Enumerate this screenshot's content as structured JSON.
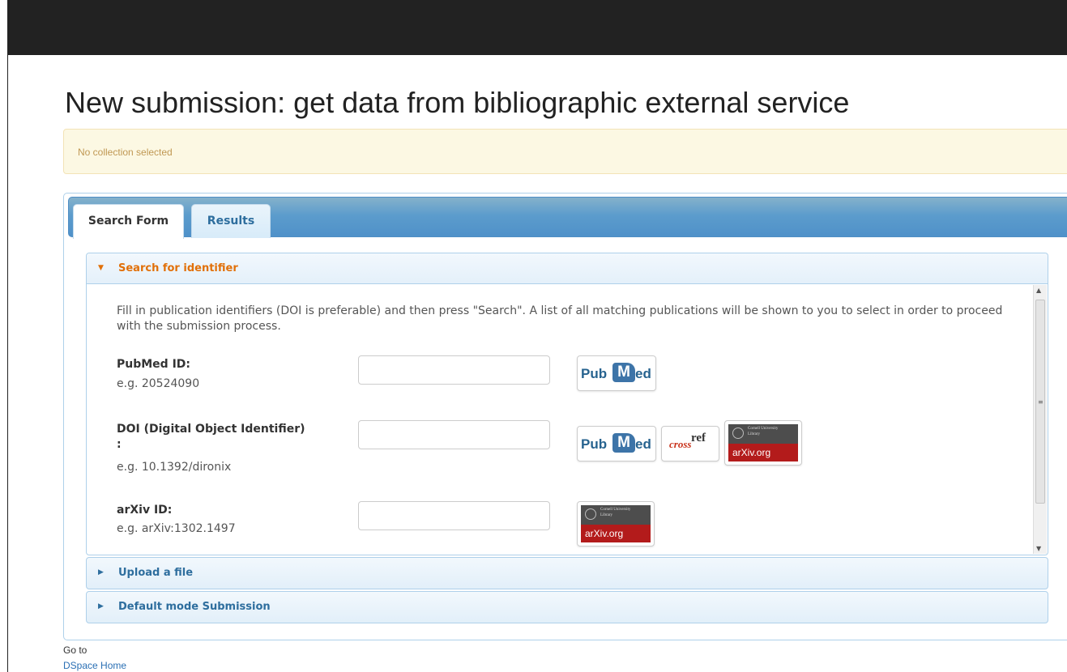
{
  "header": {
    "title": "New submission: get data from bibliographic external service"
  },
  "alert": {
    "text": "No collection selected"
  },
  "tabs": [
    {
      "label": "Search Form",
      "active": true
    },
    {
      "label": "Results",
      "active": false
    }
  ],
  "accordion": {
    "search": {
      "label": "Search for identifier",
      "description": "Fill in publication identifiers (DOI is preferable) and then press \"Search\". A list of all matching publications will be shown to you to select in order to proceed with the submission process.",
      "fields": [
        {
          "label": "PubMed ID:",
          "example": "e.g. 20524090",
          "value": "",
          "providers": [
            "pubmed"
          ]
        },
        {
          "label": "DOI (Digital Object Identifier)\n:",
          "example": "e.g. 10.1392/dironix",
          "value": "",
          "providers": [
            "pubmed",
            "crossref",
            "arxiv"
          ]
        },
        {
          "label": "arXiv ID:",
          "example": "e.g. arXiv:1302.1497",
          "value": "",
          "providers": [
            "arxiv"
          ]
        }
      ]
    },
    "upload": {
      "label": "Upload a file"
    },
    "default": {
      "label": "Default mode Submission"
    }
  },
  "logos": {
    "pubmed": {
      "pub": "Pub",
      "m": "M",
      "ed": "ed"
    },
    "crossref": {
      "part1": "cross",
      "part2": "ref"
    },
    "arxiv": {
      "university": "Cornell University\nLibrary",
      "site": "arXiv.org"
    }
  },
  "footer": {
    "goto": "Go to",
    "home_link": "DSpace Home"
  },
  "colors": {
    "accent_open": "#e17009",
    "accent_closed": "#2e6e9e",
    "topbar": "#222222"
  }
}
